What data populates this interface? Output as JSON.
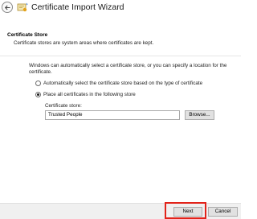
{
  "window": {
    "title": "Certificate Import Wizard",
    "back_icon": "back-arrow-icon",
    "wizard_icon": "certificate-icon"
  },
  "header": {
    "title": "Certificate Store",
    "description": "Certificate stores are system areas where certificates are kept."
  },
  "body": {
    "intro": "Windows can automatically select a certificate store, or you can specify a location for the certificate.",
    "options": [
      {
        "label": "Automatically select the certificate store based on the type of certificate",
        "selected": false
      },
      {
        "label": "Place all certificates in the following store",
        "selected": true
      }
    ],
    "store_label": "Certificate store:",
    "store_value": "Trusted People",
    "browse_label": "Browse..."
  },
  "footer": {
    "next_label": "Next",
    "cancel_label": "Cancel",
    "highlight_color": "#e2231a"
  }
}
